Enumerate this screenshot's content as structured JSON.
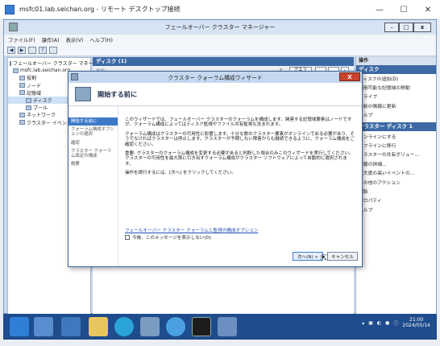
{
  "rdp": {
    "title": "msfc01.lab.seichan.org - リモート デスクトップ接続",
    "minimize": "—",
    "maximize": "☐",
    "close": "✕"
  },
  "fcm": {
    "title": "フェールオーバー クラスター マネージャー",
    "menu": [
      "ファイル(F)",
      "操作(A)",
      "表示(V)",
      "ヘルプ(H)"
    ],
    "tree": [
      {
        "label": "フェールオーバー クラスター マネージ",
        "indent": 0
      },
      {
        "label": "msfc.lab.seichan.org",
        "indent": 1
      },
      {
        "label": "役割",
        "indent": 2
      },
      {
        "label": "ノード",
        "indent": 2
      },
      {
        "label": "記憶域",
        "indent": 2
      },
      {
        "label": "ディスク",
        "indent": 3
      },
      {
        "label": "プール",
        "indent": 3
      },
      {
        "label": "ネットワーク",
        "indent": 2
      },
      {
        "label": "クラスター イベント",
        "indent": 2
      }
    ],
    "middle_header": "ディスク (1)",
    "search_placeholder": "検索",
    "search_query_btn": "クエリ",
    "actions": {
      "header": "操作",
      "section1": "ディスク",
      "items1": [
        "ディスクの追加(D)",
        "使用可能な記憶域の移動",
        "ドライブ",
        "最新の情報に更新",
        "ヘルプ"
      ],
      "section2": "クラスター ディスク 1",
      "items2": [
        "オンラインにする",
        "オフラインに移行",
        "クラスターの共有ボリュー...",
        "情報の詳細...",
        "重大度の高いイベントの...",
        "その他のアクション",
        "削除",
        "プロパティ",
        "ヘルプ"
      ]
    }
  },
  "wizard": {
    "title": "クラスター クォーラム構成ウィザード",
    "close": "X",
    "heading": "開始する前に",
    "nav": [
      "開始する前に",
      "クォーラム構成オプションの選択",
      "確認",
      "クラスター クォーラム設定の構成",
      "概要"
    ],
    "paragraphs": [
      "このウィザードでは、フェールオーバー クラスターのクォーラムを構成します。関連する記憶域要素はノードですが、クォーラム構成によってはディスク監視やファイル共有監視も含まれます。",
      "クォーラム構成はクラスターの可用性に影響します。十分な数のクラスター要素がオンラインである必要があり、そうでなければクラスターは停止します。クラスターが予期しない障害からも継続できるように、クォーラム構成をご確認ください。",
      "重要: クラスターのクォーラム構成を変更する必要があると判断した場合のみこのウィザードを実行してください。クラスターの可用性を最大限に引き出すクォーラム構成がクラスター ソフトウェアによって自動的に選択されます。",
      "操作を続行するには、[次へ] をクリックしてください。"
    ],
    "link": "フェールオーバー クラスター クォーラムと監視の構成オプション",
    "checkbox": "今後、このメッセージを表示しない(D)",
    "next": "次へ(N) >",
    "cancel": "キャンセル"
  },
  "taskbar": {
    "time": "21:00",
    "date": "2024/05/14"
  }
}
